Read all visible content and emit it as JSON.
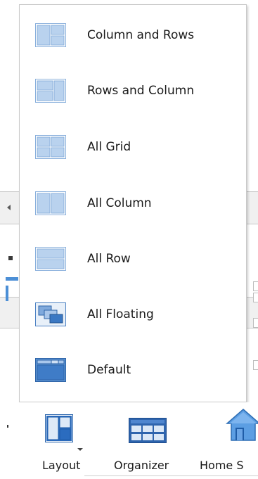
{
  "layout_menu": {
    "items": [
      {
        "label": "Column and Rows",
        "icon": "column-and-rows-layout-icon"
      },
      {
        "label": "Rows and Column",
        "icon": "rows-and-column-layout-icon"
      },
      {
        "label": "All Grid",
        "icon": "all-grid-layout-icon"
      },
      {
        "label": "All Column",
        "icon": "all-column-layout-icon"
      },
      {
        "label": "All Row",
        "icon": "all-row-layout-icon"
      },
      {
        "label": "All Floating",
        "icon": "all-floating-layout-icon"
      },
      {
        "label": "Default",
        "icon": "default-layout-icon"
      }
    ]
  },
  "toolbar": {
    "layout_label": "Layout",
    "organizer_label": "Organizer",
    "home_label": "Home S"
  },
  "colors": {
    "icon_fill_light": "#c9dcf2",
    "icon_border": "#6f9fd4",
    "icon_fill_dark": "#3b78c3",
    "accent_blue": "#4c8fd6"
  }
}
